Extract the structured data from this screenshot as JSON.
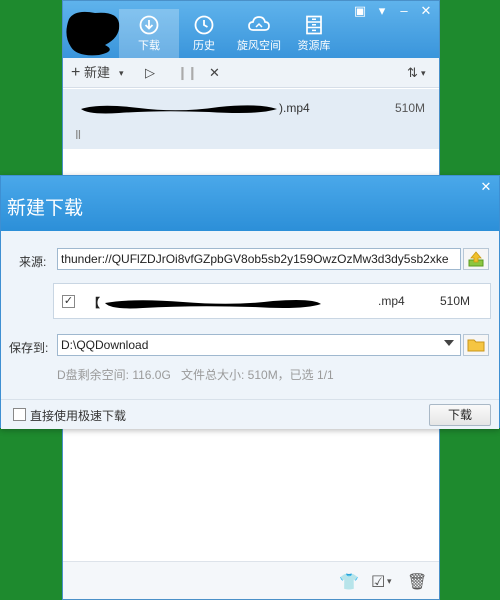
{
  "app": {
    "nav": [
      {
        "label": "下载",
        "icon": "download-circle-icon"
      },
      {
        "label": "历史",
        "icon": "history-clock-icon"
      },
      {
        "label": "旋风空间",
        "icon": "cloud-icon"
      },
      {
        "label": "资源库",
        "icon": "cabinet-icon"
      }
    ],
    "toolbar": {
      "new_label": "新建"
    },
    "task": {
      "name_suffix": ").mp4",
      "size": "510M",
      "pause_glyph": "II"
    }
  },
  "dialog": {
    "title": "新建下载",
    "close_glyph": "✕",
    "source_label": "来源:",
    "source_value": "thunder://QUFlZDJrOi8vfGZpbGV8ob5sb2y159OwzOzMw3d3dy5sb2xke",
    "file": {
      "checked": true,
      "name_prefix": "【",
      "ext": ".mp4",
      "size": "510M"
    },
    "save_label": "保存到:",
    "save_value": "D:\\QQDownload",
    "disk_space": "D盘剩余空间: 116.0G",
    "total_info": "文件总大小: 510M，已选 1/1",
    "fast_label": "直接使用极速下载",
    "download_label": "下载"
  },
  "colors": {
    "accent": "#2c8fd8",
    "background": "#1e8a2e"
  }
}
